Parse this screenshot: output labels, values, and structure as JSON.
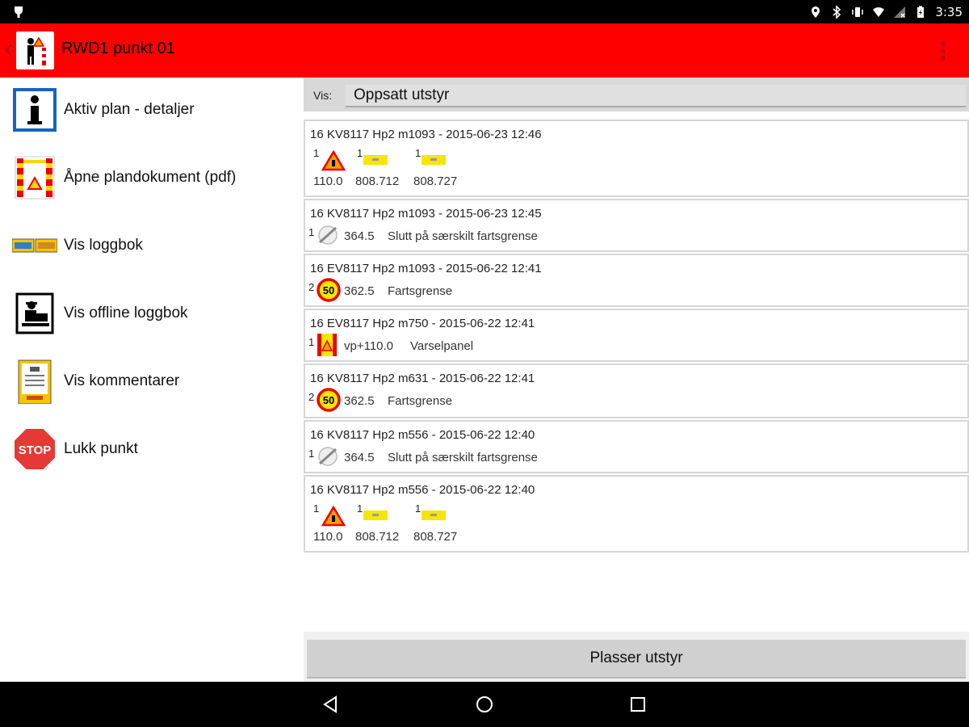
{
  "status_bar": {
    "time": "3:35"
  },
  "app_bar": {
    "title": "RWD1 punkt 01"
  },
  "menu": [
    {
      "label": "Aktiv plan - detaljer",
      "icon": "info-icon"
    },
    {
      "label": "Åpne plandokument (pdf)",
      "icon": "plan-document-icon"
    },
    {
      "label": "Vis loggbok",
      "icon": "logbook-icon"
    },
    {
      "label": "Vis offline loggbok",
      "icon": "offline-logbook-icon"
    },
    {
      "label": "Vis kommentarer",
      "icon": "comments-icon"
    },
    {
      "label": "Lukk punkt",
      "icon": "stop-icon"
    }
  ],
  "filter": {
    "label": "Vis:",
    "selected": "Oppsatt utstyr"
  },
  "entries": [
    {
      "header": "16 KV8117 Hp2 m1093 - 2015-06-23 12:46",
      "items": [
        {
          "qty": "1",
          "icon": "roadwork-warning-sign-icon",
          "value": "110.0"
        },
        {
          "qty": "1",
          "icon": "yellow-plate-icon",
          "value": "808.712"
        },
        {
          "qty": "1",
          "icon": "yellow-plate-icon",
          "value": "808.727"
        }
      ]
    },
    {
      "header": "16 KV8117 Hp2 m1093 - 2015-06-23 12:45",
      "qty": "1",
      "icon": "end-speed-limit-icon",
      "value": "364.5",
      "desc": "Slutt på særskilt fartsgrense"
    },
    {
      "header": "16 EV8117 Hp2 m1093 - 2015-06-22 12:41",
      "qty": "2",
      "icon": "speed-limit-50-icon",
      "sign_text": "50",
      "value": "362.5",
      "desc": "Fartsgrense"
    },
    {
      "header": "16 EV8117 Hp2 m750 - 2015-06-22 12:41",
      "qty": "1",
      "icon": "warning-panel-icon",
      "value": "vp+110.0",
      "desc": "Varselpanel"
    },
    {
      "header": "16 KV8117 Hp2 m631 - 2015-06-22 12:41",
      "qty": "2",
      "icon": "speed-limit-50-icon",
      "sign_text": "50",
      "value": "362.5",
      "desc": "Fartsgrense"
    },
    {
      "header": "16 KV8117 Hp2 m556 - 2015-06-22 12:40",
      "qty": "1",
      "icon": "end-speed-limit-icon",
      "value": "364.5",
      "desc": "Slutt på særskilt fartsgrense"
    },
    {
      "header": "16 KV8117 Hp2 m556 - 2015-06-22 12:40",
      "items": [
        {
          "qty": "1",
          "icon": "roadwork-warning-sign-icon",
          "value": "110.0"
        },
        {
          "qty": "1",
          "icon": "yellow-plate-icon",
          "value": "808.712"
        },
        {
          "qty": "1",
          "icon": "yellow-plate-icon",
          "value": "808.727"
        }
      ]
    }
  ],
  "place_button": "Plasser utstyr",
  "colors": {
    "app_bar": "#ff0000",
    "status_bar": "#000000",
    "nav_bar": "#000000"
  }
}
